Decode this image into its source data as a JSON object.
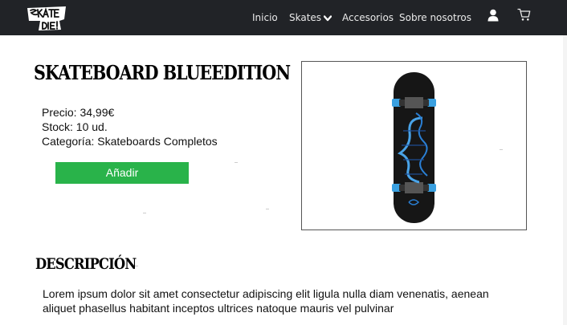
{
  "nav": {
    "logo_text": "Skate or Die!",
    "items": [
      "Inicio",
      "Skates",
      "Accesorios",
      "Sobre nosotros"
    ],
    "user_icon": "user-icon",
    "cart_icon": "cart-icon",
    "chevron_icon": "chevron-down-icon"
  },
  "product": {
    "title": "SKATEBOARD BLUEEDITION",
    "price": "Precio: 34,99€",
    "stock": "Stock: 10 ud.",
    "category": "Categoría: Skateboards Completos",
    "add_label": "Añadir",
    "image_icon": "skateboard-image"
  },
  "description": {
    "heading": "DESCRIPCIÓN",
    "text": "Lorem ipsum dolor sit amet consectetur adipiscing elit ligula nulla diam venenatis, aenean aliquet phasellus habitant inceptos ultrices natoque mauris vel pulvinar"
  },
  "colors": {
    "navbar": "#212327",
    "add_button": "#29b34a",
    "deck": "#161616",
    "wheels": "#3aa0e0"
  }
}
